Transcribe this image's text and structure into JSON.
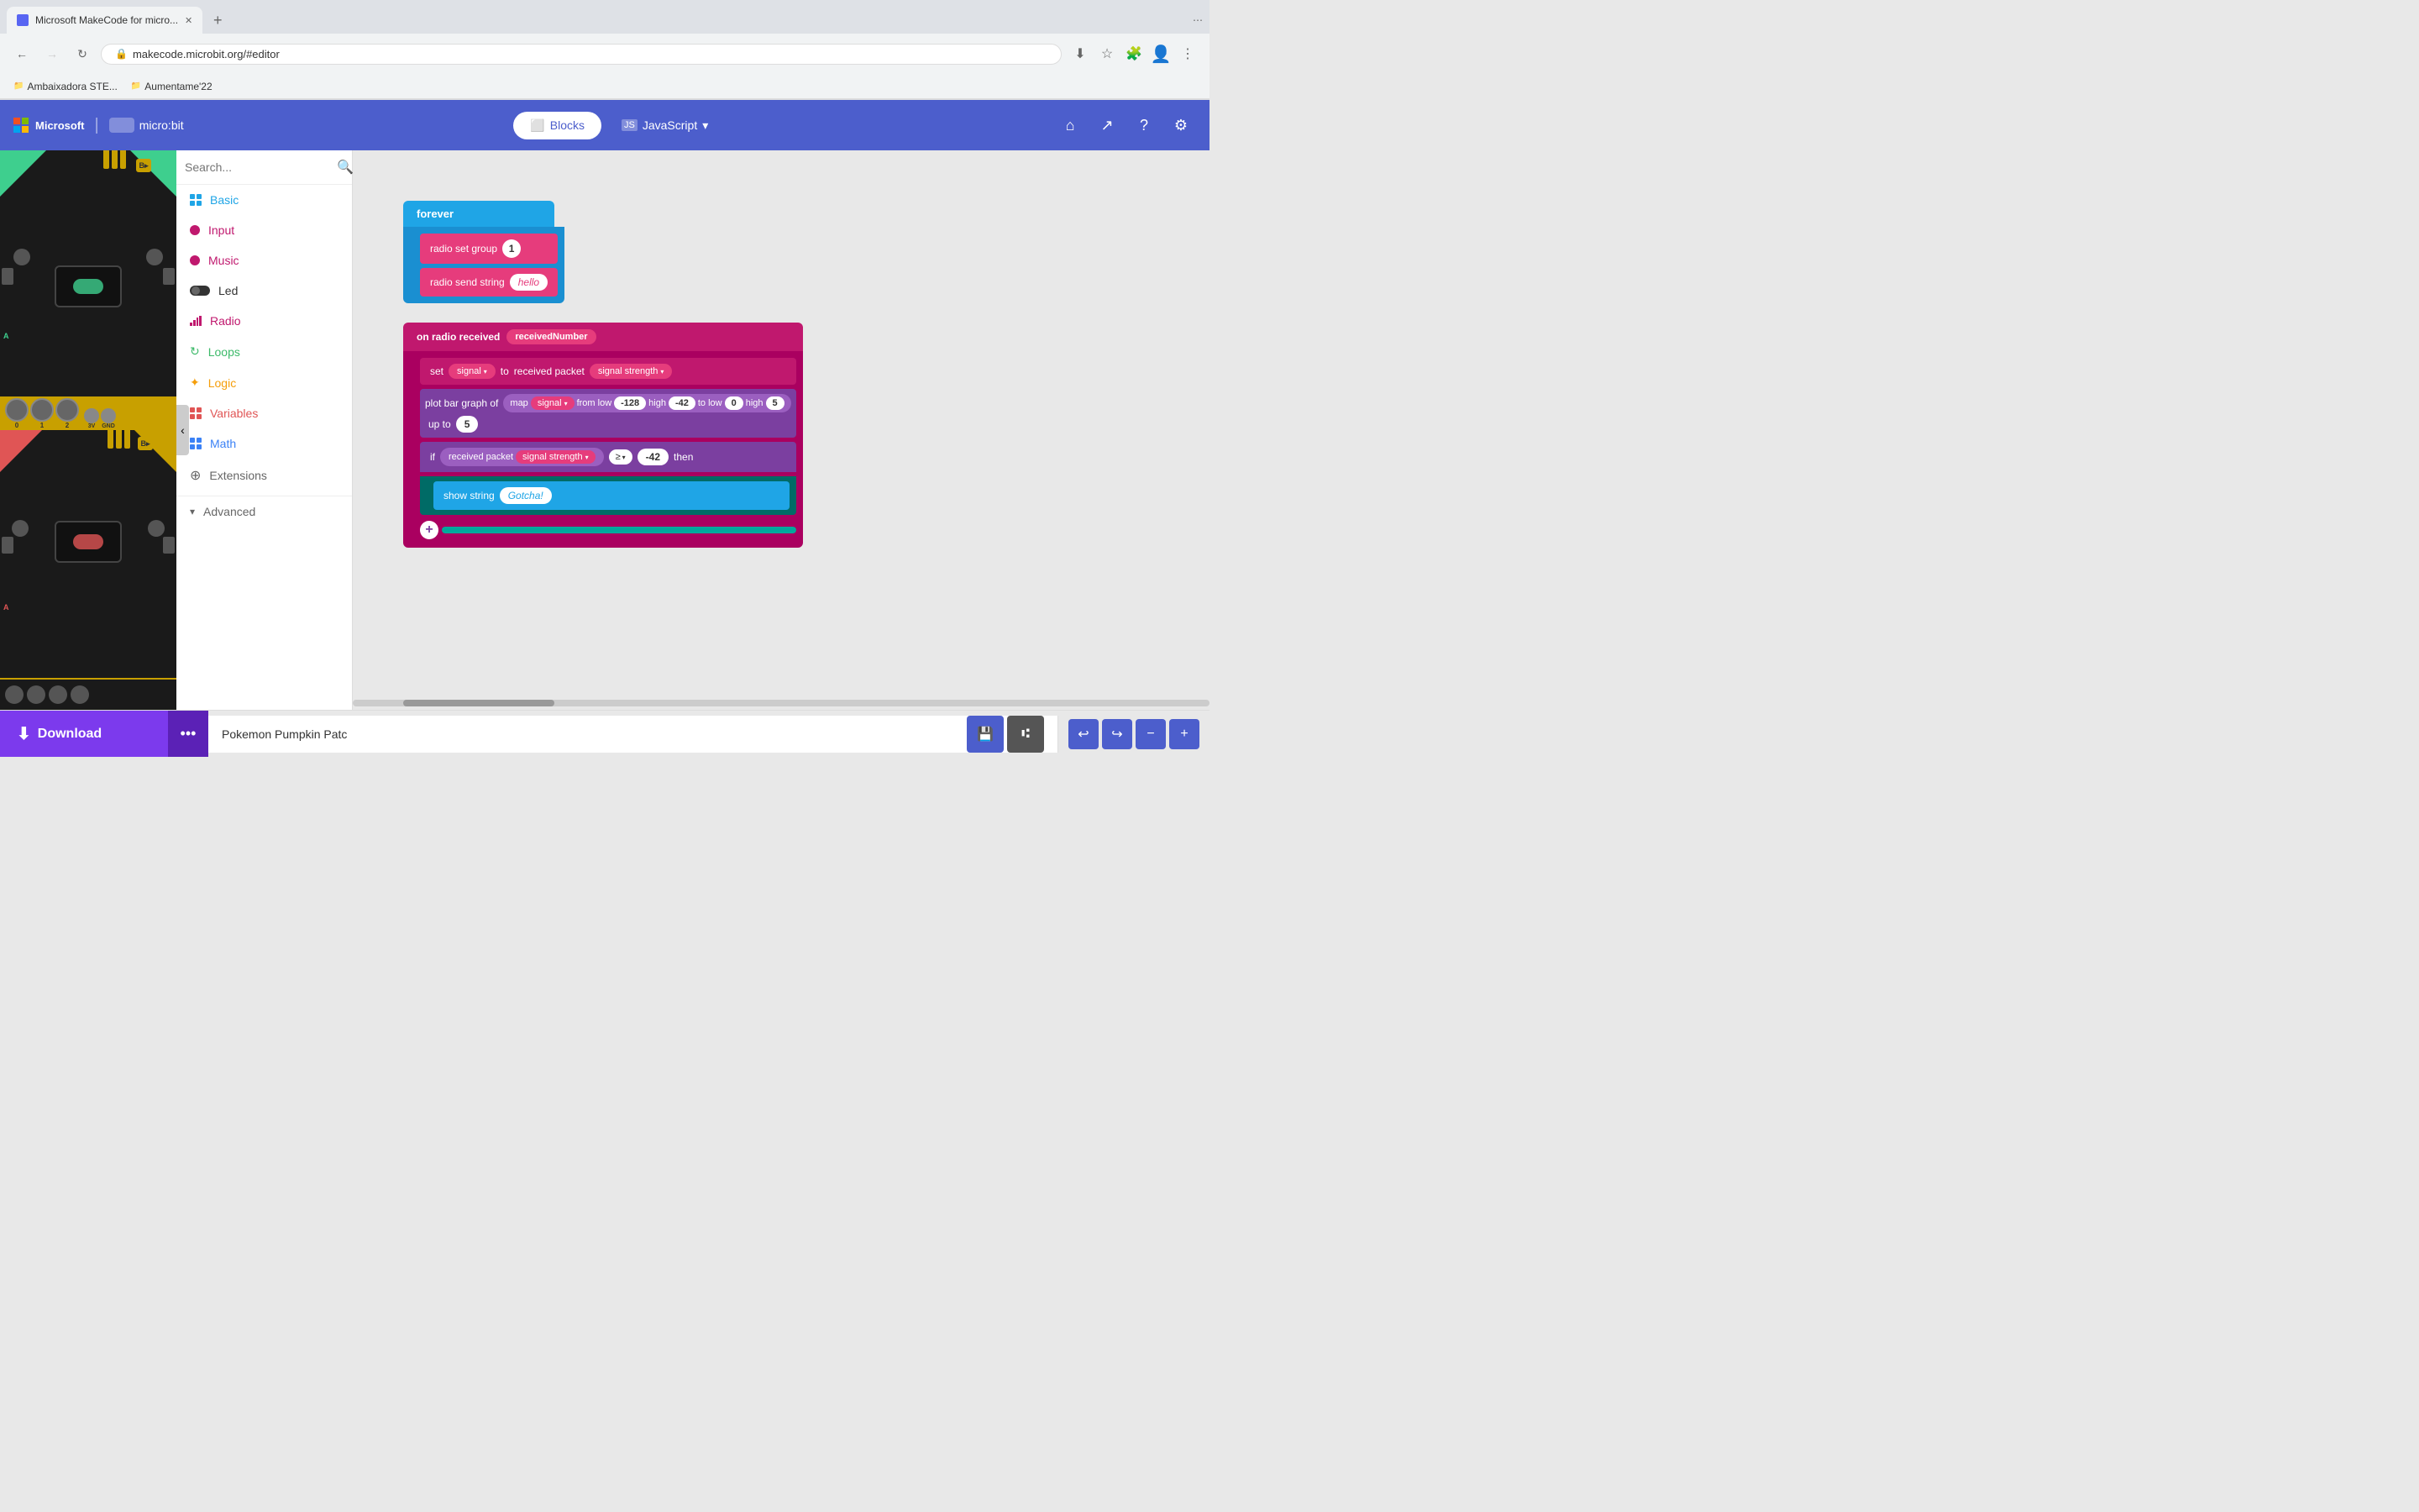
{
  "browser": {
    "tab_title": "Microsoft MakeCode for micro...",
    "url": "makecode.microbit.org/#editor",
    "bookmarks": [
      "Ambaixadora STE...",
      "Aumentame'22"
    ],
    "new_tab_label": "+"
  },
  "header": {
    "microsoft_label": "Microsoft",
    "microbit_label": "micro:bit",
    "blocks_label": "Blocks",
    "javascript_label": "JavaScript",
    "home_icon": "⌂",
    "share_icon": "↗",
    "help_icon": "?",
    "settings_icon": "⚙"
  },
  "sidebar": {
    "search_placeholder": "Search...",
    "items": [
      {
        "label": "Basic",
        "color": "#1fa5e6",
        "type": "grid"
      },
      {
        "label": "Input",
        "color": "#c0186e",
        "type": "dot"
      },
      {
        "label": "Music",
        "color": "#c0186e",
        "type": "dot"
      },
      {
        "label": "Led",
        "color": "#333",
        "type": "toggle"
      },
      {
        "label": "Radio",
        "color": "#c0186e",
        "type": "bars"
      },
      {
        "label": "Loops",
        "color": "#3dba6a",
        "type": "refresh"
      },
      {
        "label": "Logic",
        "color": "#f59e0b",
        "type": "logic"
      },
      {
        "label": "Variables",
        "color": "#e05555",
        "type": "grid2"
      },
      {
        "label": "Math",
        "color": "#3b82f6",
        "type": "grid2"
      },
      {
        "label": "Extensions",
        "color": "#666",
        "type": "plus"
      }
    ],
    "advanced_label": "Advanced"
  },
  "blocks": {
    "forever": "forever",
    "radio_set_group": "radio set group",
    "group_value": "1",
    "radio_send_string": "radio send string",
    "hello_value": "hello",
    "on_radio_received": "on radio received",
    "received_number": "receivedNumber",
    "set": "set",
    "signal": "signal",
    "to": "to",
    "received_packet": "received packet",
    "signal_strength": "signal strength",
    "plot_bar_graph_of": "plot bar graph of",
    "map": "map",
    "from_low": "from low",
    "low_val1": "-128",
    "high": "high",
    "high_val1": "-42",
    "to_low": "to low",
    "low_val2": "0",
    "high_val2": "5",
    "up_to": "up to",
    "up_to_val": "5",
    "if": "if",
    "gte": "≥",
    "compare_val": "-42",
    "then": "then",
    "show_string": "show string",
    "gotcha": "Gotcha!"
  },
  "bottom_bar": {
    "download_label": "Download",
    "project_name": "Pokemon Pumpkin Patc",
    "more_icon": "•••",
    "undo_icon": "↩",
    "redo_icon": "↪",
    "zoom_out_icon": "−",
    "zoom_in_icon": "+"
  },
  "simulator": {
    "pins": [
      "0",
      "1",
      "2",
      "3V",
      "GND"
    ],
    "btn_a": "A",
    "btn_b": "B"
  }
}
